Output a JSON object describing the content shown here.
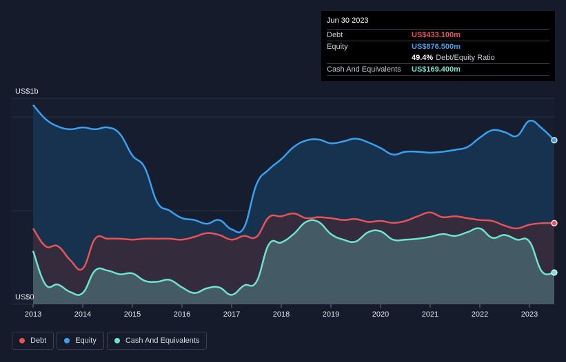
{
  "tooltip": {
    "date": "Jun 30 2023",
    "rows": [
      {
        "label": "Debt",
        "value": "US$433.100m",
        "color": "#e8535a"
      },
      {
        "label": "Equity",
        "value": "US$876.500m",
        "color": "#3aa0f0"
      }
    ],
    "ratio_value": "49.4%",
    "ratio_label": "Debt/Equity Ratio",
    "cash": {
      "label": "Cash And Equivalents",
      "value": "US$169.400m",
      "color": "#6fe3d0"
    }
  },
  "legend": [
    {
      "label": "Debt",
      "color": "#e8535a"
    },
    {
      "label": "Equity",
      "color": "#3aa0f0"
    },
    {
      "label": "Cash And Equivalents",
      "color": "#6fe3d0"
    }
  ],
  "chart_data": {
    "type": "area",
    "ylabel_top": "US$1b",
    "ylabel_bottom": "US$0",
    "ylim": [
      0,
      1100
    ],
    "xlim": [
      2013.0,
      2023.5
    ],
    "x_ticks": [
      2013,
      2014,
      2015,
      2016,
      2017,
      2018,
      2019,
      2020,
      2021,
      2022,
      2023
    ],
    "x_tick_labels": [
      "2013",
      "2014",
      "2015",
      "2016",
      "2017",
      "2018",
      "2019",
      "2020",
      "2021",
      "2022",
      "2023"
    ],
    "series": [
      {
        "name": "Equity",
        "color": "#3aa0f0",
        "x": [
          2013.0,
          2013.25,
          2013.5,
          2013.75,
          2014.0,
          2014.25,
          2014.5,
          2014.75,
          2015.0,
          2015.25,
          2015.5,
          2015.75,
          2016.0,
          2016.25,
          2016.5,
          2016.75,
          2017.0,
          2017.25,
          2017.5,
          2017.75,
          2018.0,
          2018.25,
          2018.5,
          2018.75,
          2019.0,
          2019.25,
          2019.5,
          2019.75,
          2020.0,
          2020.25,
          2020.5,
          2020.75,
          2021.0,
          2021.25,
          2021.5,
          2021.75,
          2022.0,
          2022.25,
          2022.5,
          2022.75,
          2023.0,
          2023.25,
          2023.5
        ],
        "values": [
          1065,
          990,
          950,
          935,
          945,
          935,
          945,
          910,
          795,
          730,
          545,
          500,
          460,
          450,
          430,
          450,
          400,
          410,
          640,
          720,
          775,
          840,
          875,
          880,
          860,
          870,
          885,
          865,
          835,
          800,
          815,
          815,
          810,
          815,
          825,
          840,
          890,
          930,
          920,
          900,
          980,
          940,
          876.5
        ]
      },
      {
        "name": "Debt",
        "color": "#e8535a",
        "x": [
          2013.0,
          2013.25,
          2013.5,
          2013.75,
          2014.0,
          2014.25,
          2014.5,
          2014.75,
          2015.0,
          2015.25,
          2015.5,
          2015.75,
          2016.0,
          2016.25,
          2016.5,
          2016.75,
          2017.0,
          2017.25,
          2017.5,
          2017.75,
          2018.0,
          2018.25,
          2018.5,
          2018.75,
          2019.0,
          2019.25,
          2019.5,
          2019.75,
          2020.0,
          2020.25,
          2020.5,
          2020.75,
          2021.0,
          2021.25,
          2021.5,
          2021.75,
          2022.0,
          2022.25,
          2022.5,
          2022.75,
          2023.0,
          2023.25,
          2023.5
        ],
        "values": [
          405,
          310,
          310,
          235,
          190,
          350,
          350,
          350,
          345,
          350,
          350,
          350,
          345,
          360,
          380,
          370,
          345,
          365,
          360,
          465,
          470,
          485,
          460,
          465,
          460,
          450,
          455,
          440,
          445,
          435,
          445,
          470,
          490,
          465,
          470,
          460,
          450,
          445,
          420,
          405,
          425,
          433,
          433.1
        ]
      },
      {
        "name": "Cash And Equivalents",
        "color": "#6fe3d0",
        "x": [
          2013.0,
          2013.25,
          2013.5,
          2013.75,
          2014.0,
          2014.25,
          2014.5,
          2014.75,
          2015.0,
          2015.25,
          2015.5,
          2015.75,
          2016.0,
          2016.25,
          2016.5,
          2016.75,
          2017.0,
          2017.25,
          2017.5,
          2017.75,
          2018.0,
          2018.25,
          2018.5,
          2018.75,
          2019.0,
          2019.25,
          2019.5,
          2019.75,
          2020.0,
          2020.25,
          2020.5,
          2020.75,
          2021.0,
          2021.25,
          2021.5,
          2021.75,
          2022.0,
          2022.25,
          2022.5,
          2022.75,
          2023.0,
          2023.25,
          2023.5
        ],
        "values": [
          285,
          105,
          105,
          65,
          60,
          180,
          180,
          160,
          165,
          125,
          120,
          130,
          90,
          60,
          85,
          90,
          50,
          100,
          120,
          320,
          330,
          375,
          440,
          440,
          375,
          345,
          335,
          385,
          390,
          345,
          345,
          350,
          360,
          375,
          365,
          385,
          405,
          355,
          370,
          345,
          335,
          175,
          169.4
        ]
      }
    ]
  }
}
